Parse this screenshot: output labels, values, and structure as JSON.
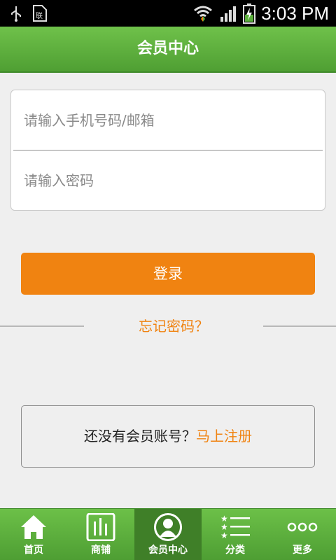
{
  "status_bar": {
    "time": "3:03 PM"
  },
  "header": {
    "title": "会员中心"
  },
  "login_form": {
    "account_placeholder": "请输入手机号码/邮箱",
    "password_placeholder": "请输入密码",
    "login_label": "登录",
    "forgot_label": "忘记密码？"
  },
  "register": {
    "prompt": "还没有会员账号？",
    "link": "马上注册"
  },
  "tabs": [
    {
      "label": "首页",
      "icon": "home-icon"
    },
    {
      "label": "商铺",
      "icon": "shop-icon"
    },
    {
      "label": "会员中心",
      "icon": "member-icon",
      "active": true
    },
    {
      "label": "分类",
      "icon": "category-list-icon"
    },
    {
      "label": "更多",
      "icon": "more-dots-icon"
    }
  ],
  "colors": {
    "brand_green": "#5aae3b",
    "accent_orange": "#f08311"
  }
}
